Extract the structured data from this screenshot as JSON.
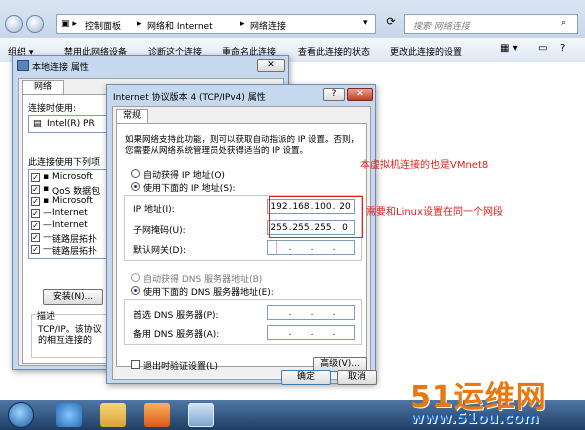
{
  "explorer": {
    "breadcrumb": [
      "控制面板",
      "网络和 Internet",
      "网络连接"
    ],
    "search_placeholder": "搜索 网络连接",
    "toolbar": [
      "组织 ▾",
      "禁用此网络设备",
      "诊断这个连接",
      "重命名此连接",
      "查看此连接的状态",
      "更改此连接的设置"
    ]
  },
  "props_window": {
    "title": "本地连接 属性",
    "tab": "网络",
    "connect_using_label": "连接时使用:",
    "adapter": "Intel(R) PR",
    "items_label": "此连接使用下列项",
    "items": [
      {
        "label": "Microsoft",
        "checked": true
      },
      {
        "label": "QoS 数据包",
        "checked": true
      },
      {
        "label": "Microsoft",
        "checked": true
      },
      {
        "label": "Internet",
        "checked": true
      },
      {
        "label": "Internet",
        "checked": true
      },
      {
        "label": "链路层拓扑",
        "checked": true
      },
      {
        "label": "链路层拓扑",
        "checked": true
      }
    ],
    "install_button": "安装(N)...",
    "description_label": "描述",
    "description_lines": [
      "TCP/IP。该协议",
      "的相互连接的"
    ]
  },
  "ipv4_dialog": {
    "title": "Internet 协议版本 4 (TCP/IPv4) 属性",
    "help_button": "?",
    "close_button": "✕",
    "tab": "常规",
    "intro_lines": [
      "如果网络支持此功能，则可以获取自动指派的 IP 设置。否则，",
      "您需要从网络系统管理员处获得适当的 IP 设置。"
    ],
    "auto_ip": "自动获得 IP 地址(O)",
    "manual_ip": "使用下面的 IP 地址(S):",
    "ip_label": "IP 地址(I):",
    "ip_value": [
      "192",
      "168",
      "100",
      "20"
    ],
    "mask_label": "子网掩码(U):",
    "mask_value": [
      "255",
      "255",
      "255",
      "0"
    ],
    "gateway_label": "默认网关(D):",
    "auto_dns": "自动获得 DNS 服务器地址(B)",
    "manual_dns": "使用下面的 DNS 服务器地址(E):",
    "pref_dns_label": "首选 DNS 服务器(P):",
    "alt_dns_label": "备用 DNS 服务器(A):",
    "validate": "退出时验证设置(L)",
    "advanced_button": "高级(V)...",
    "ok_button": "确定",
    "cancel_button": "取消"
  },
  "annotations": {
    "note1": "本虚拟机连接的也是VMnet8",
    "note2": "需要和Linux设置在同一个网段"
  },
  "watermark": {
    "brand": "51运维网",
    "url": "www.51ou.com"
  },
  "colors": {
    "annotation": "#e0201a",
    "brand_orange": "#e8780f",
    "brand_blue": "#1a5fb4"
  }
}
